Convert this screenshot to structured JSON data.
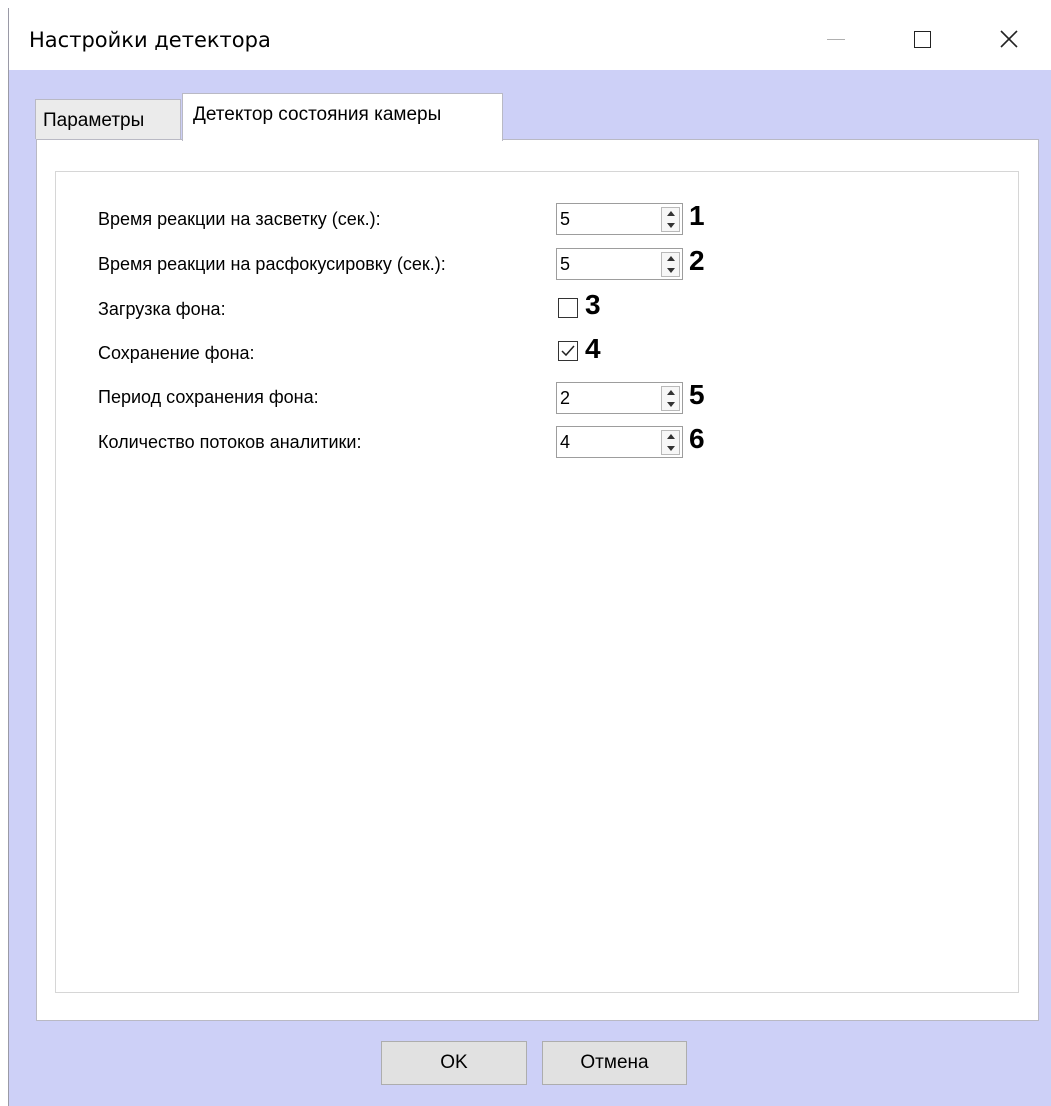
{
  "window": {
    "title": "Настройки детектора",
    "minimize_icon": "minimize-icon",
    "maximize_icon": "maximize-icon",
    "close_icon": "close-icon"
  },
  "tabs": [
    {
      "label": "Параметры",
      "active": false
    },
    {
      "label": "Детектор состояния камеры",
      "active": true
    }
  ],
  "fields": {
    "flare_time": {
      "label": "Время реакции на засветку (сек.):",
      "value": "5",
      "marker": "1"
    },
    "defocus_time": {
      "label": "Время реакции на расфокусировку (сек.):",
      "value": "5",
      "marker": "2"
    },
    "bg_load": {
      "label": "Загрузка фона:",
      "checked": false,
      "marker": "3"
    },
    "bg_save": {
      "label": "Сохранение фона:",
      "checked": true,
      "marker": "4"
    },
    "bg_period": {
      "label": "Период сохранения фона:",
      "value": "2",
      "marker": "5"
    },
    "threads": {
      "label": "Количество потоков аналитики:",
      "value": "4",
      "marker": "6"
    }
  },
  "buttons": {
    "ok": "OK",
    "cancel": "Отмена"
  },
  "colors": {
    "dialog_background": "#cdd0f7",
    "top_text": "#1f3e8f"
  }
}
